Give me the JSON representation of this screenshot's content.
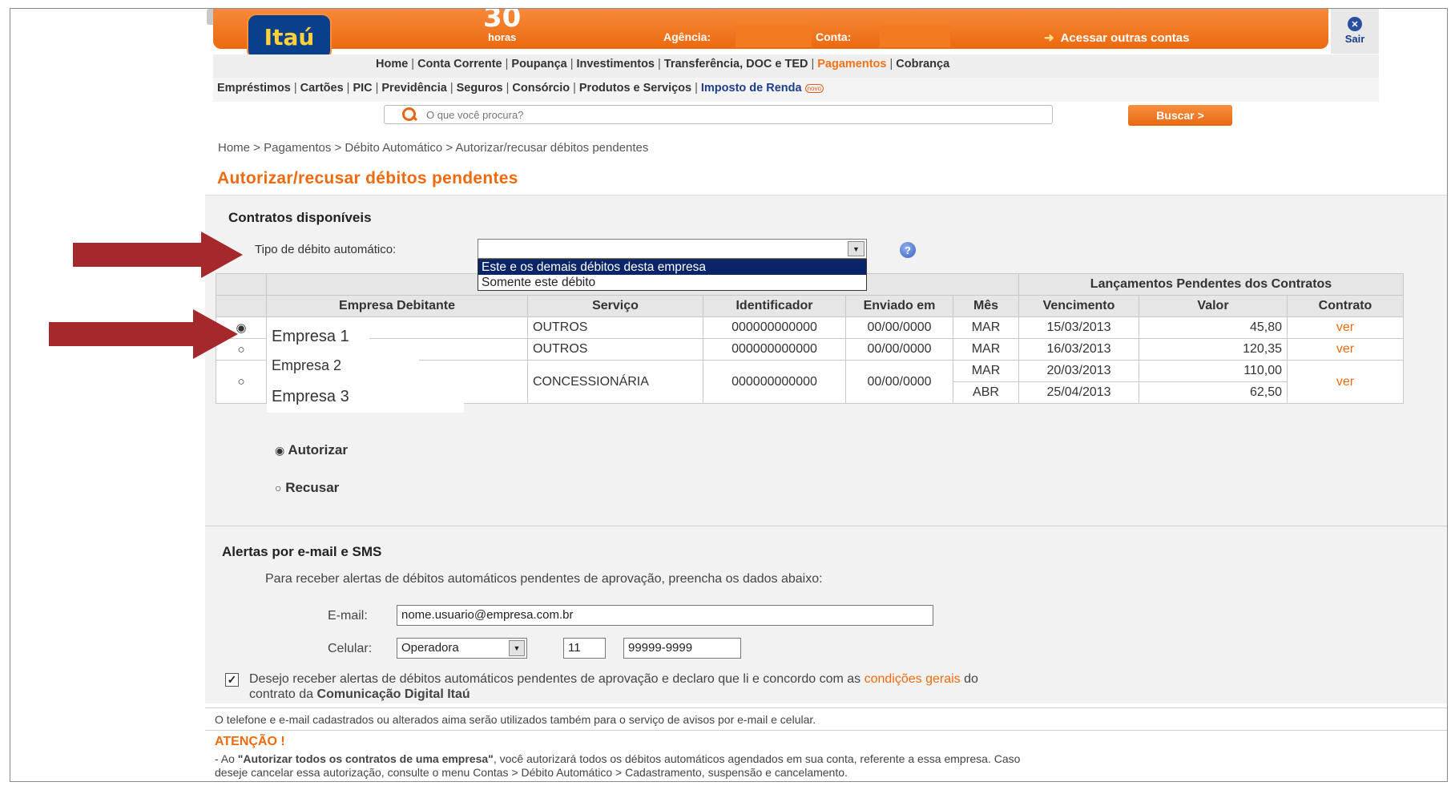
{
  "header": {
    "logo": "Itaú",
    "brand_number": "30",
    "brand_word": "horas",
    "agencia_label": "Agência:",
    "conta_label": "Conta:",
    "acessar_outras": "Acessar outras contas",
    "sair": "Sair"
  },
  "nav1": [
    {
      "label": "Home"
    },
    {
      "label": "Conta Corrente"
    },
    {
      "label": "Poupança"
    },
    {
      "label": "Investimentos"
    },
    {
      "label": "Transferência, DOC e TED"
    },
    {
      "label": "Pagamentos",
      "active": true
    },
    {
      "label": "Cobrança"
    }
  ],
  "nav2": [
    {
      "label": "Empréstimos"
    },
    {
      "label": "Cartões"
    },
    {
      "label": "PIC"
    },
    {
      "label": "Previdência"
    },
    {
      "label": "Seguros"
    },
    {
      "label": "Consórcio"
    },
    {
      "label": "Produtos e Serviços"
    },
    {
      "label": "Imposto de Renda",
      "badge": "novo"
    }
  ],
  "search": {
    "placeholder": "O que você procura?",
    "button": "Buscar >"
  },
  "breadcrumb": "Home > Pagamentos > Débito Automático > Autorizar/recusar débitos pendentes",
  "page_title": "Autorizar/recusar débitos pendentes",
  "contracts": {
    "section_title": "Contratos disponíveis",
    "tipo_label": "Tipo de débito automático:",
    "help": "?",
    "dropdown_options": [
      "Este e os demais débitos desta empresa",
      "Somente este débito"
    ],
    "group_header": "Lançamentos Pendentes dos Contratos",
    "columns": [
      "Empresa Debitante",
      "Serviço",
      "Identificador",
      "Enviado em",
      "Mês",
      "Vencimento",
      "Valor",
      "Contrato"
    ],
    "rows": [
      {
        "empresa": "Empresa 1",
        "servico": "OUTROS",
        "identificador": "000000000000",
        "enviado": "00/00/0000",
        "mes": "MAR",
        "vencimento": "15/03/2013",
        "valor": "45,80",
        "contrato": "ver",
        "selected": true
      },
      {
        "empresa": "Empresa 2",
        "servico": "OUTROS",
        "identificador": "000000000000",
        "enviado": "00/00/0000",
        "mes": "MAR",
        "vencimento": "16/03/2013",
        "valor": "120,35",
        "contrato": "ver"
      },
      {
        "empresa": "Empresa 3",
        "servico": "CONCESSIONÁRIA",
        "identificador": "000000000000",
        "enviado": "00/00/0000",
        "mes": "MAR",
        "vencimento": "20/03/2013",
        "valor": "110,00",
        "contrato": "ver",
        "mes2": "ABR",
        "vencimento2": "25/04/2013",
        "valor2": "62,50"
      }
    ],
    "autorizar": "Autorizar",
    "recusar": "Recusar"
  },
  "alerts": {
    "title": "Alertas por e-mail e SMS",
    "instructions": "Para receber alertas de débitos automáticos pendentes de aprovação, preencha os dados abaixo:",
    "email_label": "E-mail:",
    "email_value": "nome.usuario@empresa.com.br",
    "celular_label": "Celular:",
    "operadora": "Operadora",
    "ddd": "11",
    "phone": "99999-9999",
    "consent_text": "Desejo receber alertas de débitos automáticos pendentes de aprovação e declaro que li e concordo com as",
    "consent_link": "condições gerais",
    "consent_after": "do",
    "consent_line2": "contrato da",
    "consent_bold": "Comunicação Digital Itaú",
    "note": "O telefone e e-mail cadastrados ou alterados aima serão utilizados também para o serviço de avisos por e-mail e celular.",
    "atencao": "ATENÇÃO !",
    "atencao_prefix": "- Ao",
    "atencao_bold": "\"Autorizar todos os contratos de uma empresa\"",
    "atencao_text": ", você autorizará todos os débitos automáticos agendados em sua conta, referente a essa empresa. Caso",
    "atencao_line2": "deseje cancelar essa autorização, consulte o menu Contas > Débito Automático > Cadastramento, suspensão e cancelamento."
  },
  "colors": {
    "brand_orange": "#ef6a0e",
    "itau_blue": "#0a3f8c",
    "arrow_red": "#a5282c"
  }
}
